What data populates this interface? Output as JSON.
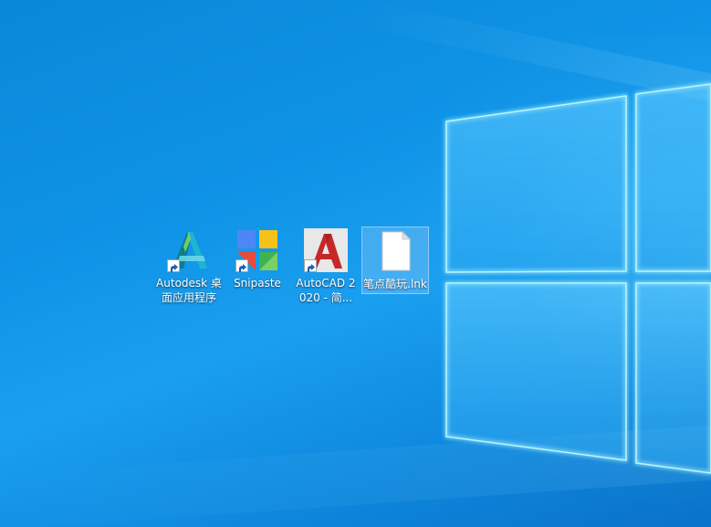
{
  "desktop": {
    "icons": [
      {
        "label": "Autodesk 桌面应用程序",
        "icon": "autodesk-logo-icon",
        "shortcut": true
      },
      {
        "label": "Snipaste",
        "icon": "snipaste-logo-icon",
        "shortcut": true
      },
      {
        "label": "AutoCAD 2020 - 简...",
        "icon": "autocad-logo-icon",
        "shortcut": true
      },
      {
        "label": "笔点酷玩.lnk",
        "icon": "blank-file-icon",
        "shortcut": false,
        "selected": true
      }
    ]
  },
  "colors": {
    "background": "#0f93e6",
    "pane_edge": "#8cebff",
    "autocad_red": "#c62828",
    "snipaste_blue": "#4f86f7",
    "snipaste_yellow": "#f6c21a",
    "snipaste_green": "#3fb34f",
    "snipaste_red": "#e84a3c"
  }
}
